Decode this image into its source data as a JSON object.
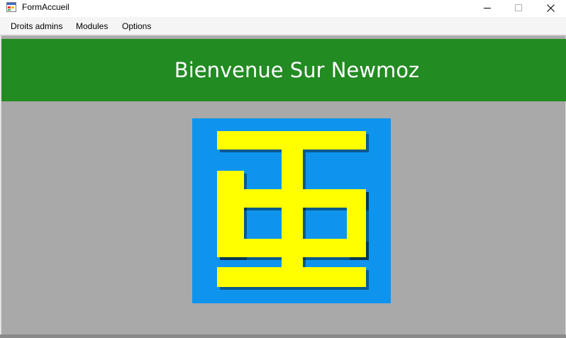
{
  "window": {
    "title": "FormAccueil",
    "icons": {
      "app": "form-app-icon",
      "minimize": "minimize-icon",
      "maximize": "maximize-icon",
      "close": "close-icon"
    }
  },
  "menubar": {
    "items": [
      {
        "label": "Droits admins"
      },
      {
        "label": "Modules"
      },
      {
        "label": "Options"
      }
    ]
  },
  "banner": {
    "title": "Bienvenue Sur Newmoz",
    "background": "#228b22",
    "text_color": "#ffffff"
  },
  "logo": {
    "icon": "newmoz-logo",
    "background": "#0f94ee",
    "foreground": "#ffff00"
  },
  "colors": {
    "client_background": "#a9a9a9"
  }
}
